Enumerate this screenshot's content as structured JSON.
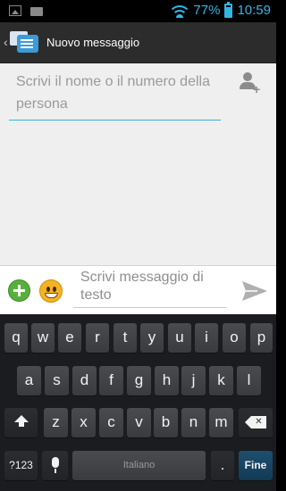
{
  "status_bar": {
    "battery": "77%",
    "battery_level": 0.77,
    "time": "10:59",
    "icons": [
      "image-icon",
      "device-icon",
      "wifi-icon",
      "battery-icon"
    ]
  },
  "action_bar": {
    "title": "Nuovo messaggio",
    "app_icon": "messaging-app-icon"
  },
  "recipient": {
    "placeholder": "Scrivi il nome o il numero della persona",
    "add_contact_icon": "add-contact-icon"
  },
  "compose": {
    "placeholder": "Scrivi messaggio di testo",
    "attach_icon": "add-attachment-icon",
    "emoji_icon": "smiley-icon",
    "send_icon": "send-icon"
  },
  "keyboard": {
    "row1": [
      "q",
      "w",
      "e",
      "r",
      "t",
      "y",
      "u",
      "i",
      "o",
      "p"
    ],
    "row2": [
      "a",
      "s",
      "d",
      "f",
      "g",
      "h",
      "j",
      "k",
      "l"
    ],
    "row3": [
      "z",
      "x",
      "c",
      "v",
      "b",
      "n",
      "m"
    ],
    "symbols_label": "?123",
    "space_label": "Italiano",
    "period_label": ".",
    "action_label": "Fine"
  },
  "colors": {
    "accent": "#33b5e5",
    "keyboard_bg": "#1b1c1f",
    "key_bg": "#434448",
    "action_key_bg": "#1e4f6e"
  }
}
